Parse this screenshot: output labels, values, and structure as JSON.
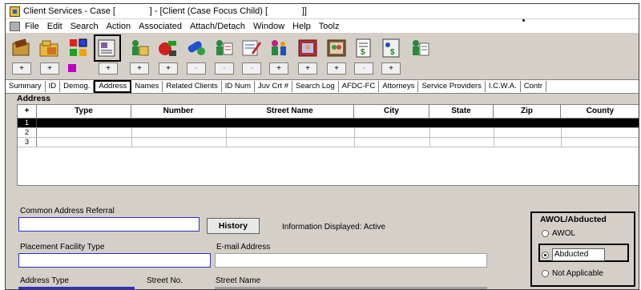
{
  "window": {
    "title": "Client Services - Case [              ] - [Client (Case Focus Child) [              ]]"
  },
  "menu": [
    "File",
    "Edit",
    "Search",
    "Action",
    "Associated",
    "Attach/Detach",
    "Window",
    "Help",
    "Toolz"
  ],
  "toolbar": {
    "buttons": [
      {
        "icon": "case-folder-icon",
        "plus": "+",
        "plus_enabled": true
      },
      {
        "icon": "open-folder-icon",
        "plus": "+",
        "plus_enabled": true
      },
      {
        "icon": "color-squares-icon",
        "plus": "",
        "plus_enabled": false
      },
      {
        "icon": "address-card-icon",
        "plus": "+",
        "plus_enabled": true
      },
      {
        "icon": "person-folder-icon",
        "plus": "+",
        "plus_enabled": true
      },
      {
        "icon": "medical-items-icon",
        "plus": "+",
        "plus_enabled": true
      },
      {
        "icon": "person-medicine-icon",
        "plus": "-",
        "plus_enabled": false
      },
      {
        "icon": "notes-edit-icon",
        "plus": "-",
        "plus_enabled": false
      },
      {
        "icon": "person-info-icon",
        "plus": "-",
        "plus_enabled": false
      },
      {
        "icon": "photo-frame-icon",
        "plus": "+",
        "plus_enabled": true
      },
      {
        "icon": "family-photo-icon",
        "plus": "+",
        "plus_enabled": true
      },
      {
        "icon": "ledger-dollar-icon",
        "plus": "+",
        "plus_enabled": true
      },
      {
        "icon": "money-document-icon",
        "plus": "-",
        "plus_enabled": false
      },
      {
        "icon": "person-list-icon",
        "plus": "+",
        "plus_enabled": true
      }
    ]
  },
  "tabs": [
    "Summary",
    "ID",
    "Demog.",
    "Address",
    "Names",
    "Related Clients",
    "ID Num",
    "Juv Crt #",
    "Search Log",
    "AFDC-FC",
    "Attorneys",
    "Service Providers",
    "I.C.W.A.",
    "Contr"
  ],
  "active_tab": "Address",
  "address_section": {
    "title": "Address",
    "columns": [
      "+",
      "Type",
      "Number",
      "Street Name",
      "City",
      "State",
      "Zip",
      "County"
    ],
    "rows": [
      "1",
      "2",
      "3"
    ]
  },
  "form": {
    "common_address_referral_label": "Common Address Referral",
    "common_address_referral_value": "",
    "history_button": "History",
    "info_displayed": "Information Displayed: Active",
    "placement_facility_type_label": "Placement Facility Type",
    "placement_facility_type_value": "",
    "email_label": "E-mail Address",
    "email_value": "",
    "address_type_label": "Address Type",
    "street_no_label": "Street No.",
    "street_name_label": "Street Name"
  },
  "awol_group": {
    "title": "AWOL/Abducted",
    "options": [
      "AWOL",
      "Abducted",
      "Not Applicable"
    ],
    "selected": "Abducted"
  }
}
